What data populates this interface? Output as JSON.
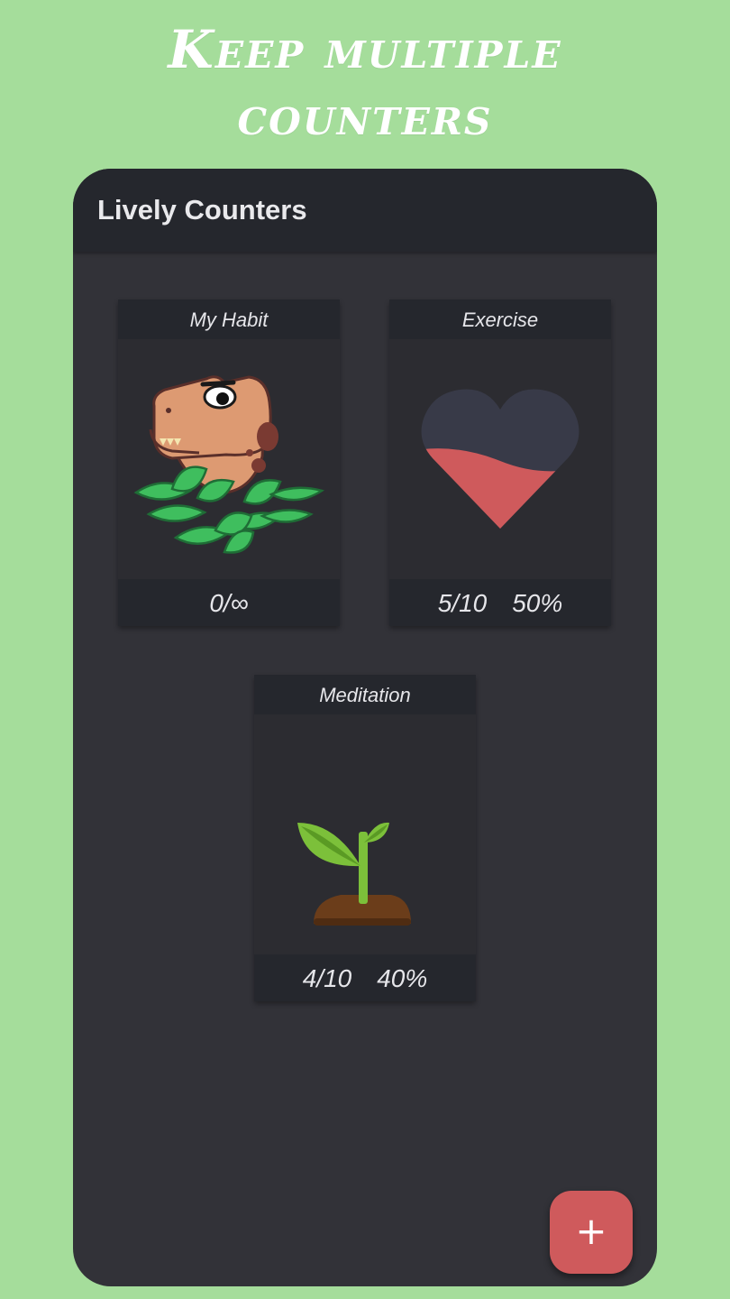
{
  "headline": {
    "line1": "Keep multiple",
    "line2": "counters"
  },
  "app": {
    "title": "Lively Counters"
  },
  "counters": [
    {
      "name": "My Habit",
      "count": "0/∞",
      "percent": "",
      "icon": "dinosaur-icon"
    },
    {
      "name": "Exercise",
      "count": "5/10",
      "percent": "50%",
      "icon": "heart-icon",
      "progress": 0.5
    },
    {
      "name": "Meditation",
      "count": "4/10",
      "percent": "40%",
      "icon": "sprout-icon",
      "progress": 0.4
    }
  ],
  "fab": {
    "label": "+",
    "icon": "plus-icon"
  },
  "colors": {
    "background": "#a5dd9b",
    "appbar": "#25272d",
    "surface": "#323238",
    "card": "#2c2c31",
    "accent": "#cf5a5c",
    "heart_empty": "#383a48"
  }
}
